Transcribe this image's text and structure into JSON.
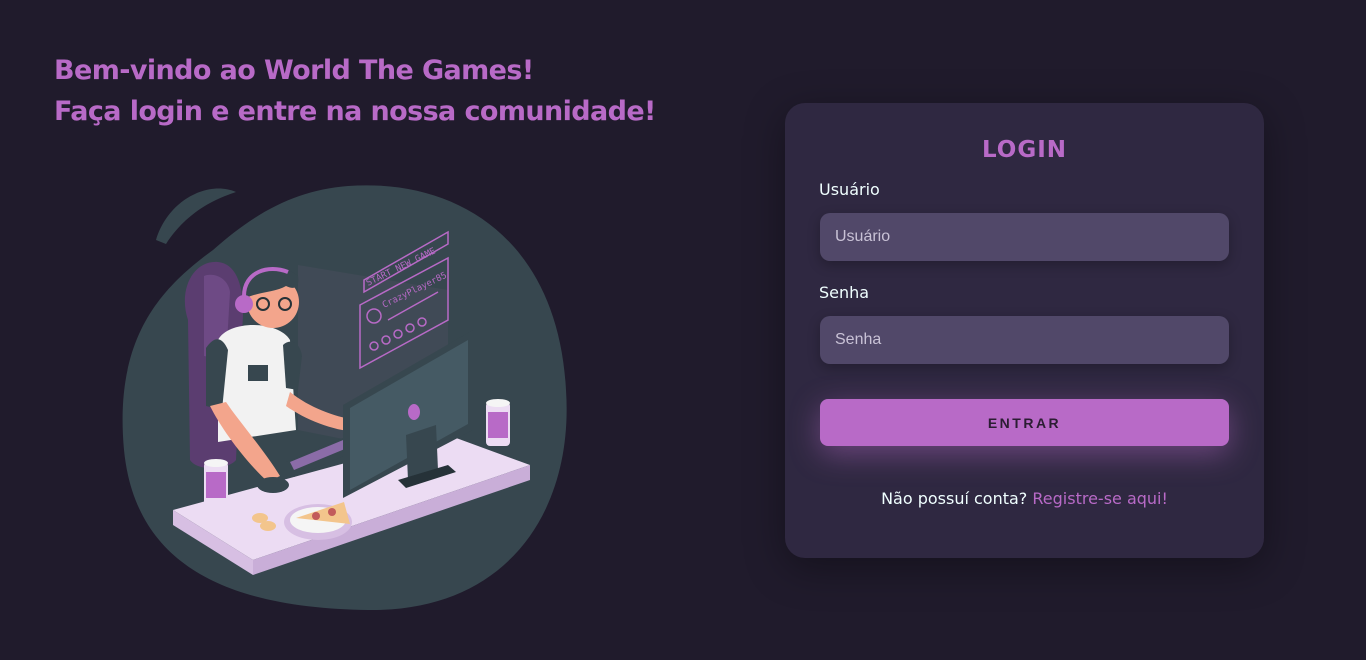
{
  "welcome": {
    "line1": "Bem-vindo ao World The Games!",
    "line2": "Faça login e entre na nossa comunidade!"
  },
  "illustration": {
    "screen_button": "START NEW GAME",
    "player_name": "CrazyPlayer85"
  },
  "login": {
    "title": "LOGIN",
    "username_label": "Usuário",
    "username_placeholder": "Usuário",
    "username_value": "",
    "password_label": "Senha",
    "password_placeholder": "Senha",
    "password_value": "",
    "submit_label": "ENTRAR",
    "signup_prompt": "Não possuí conta?",
    "signup_link": "Registre-se aqui!"
  },
  "colors": {
    "background": "#201b2c",
    "card": "#2f2841",
    "input": "#514869",
    "accent": "#b86ac7",
    "text": "#f0ffff"
  }
}
